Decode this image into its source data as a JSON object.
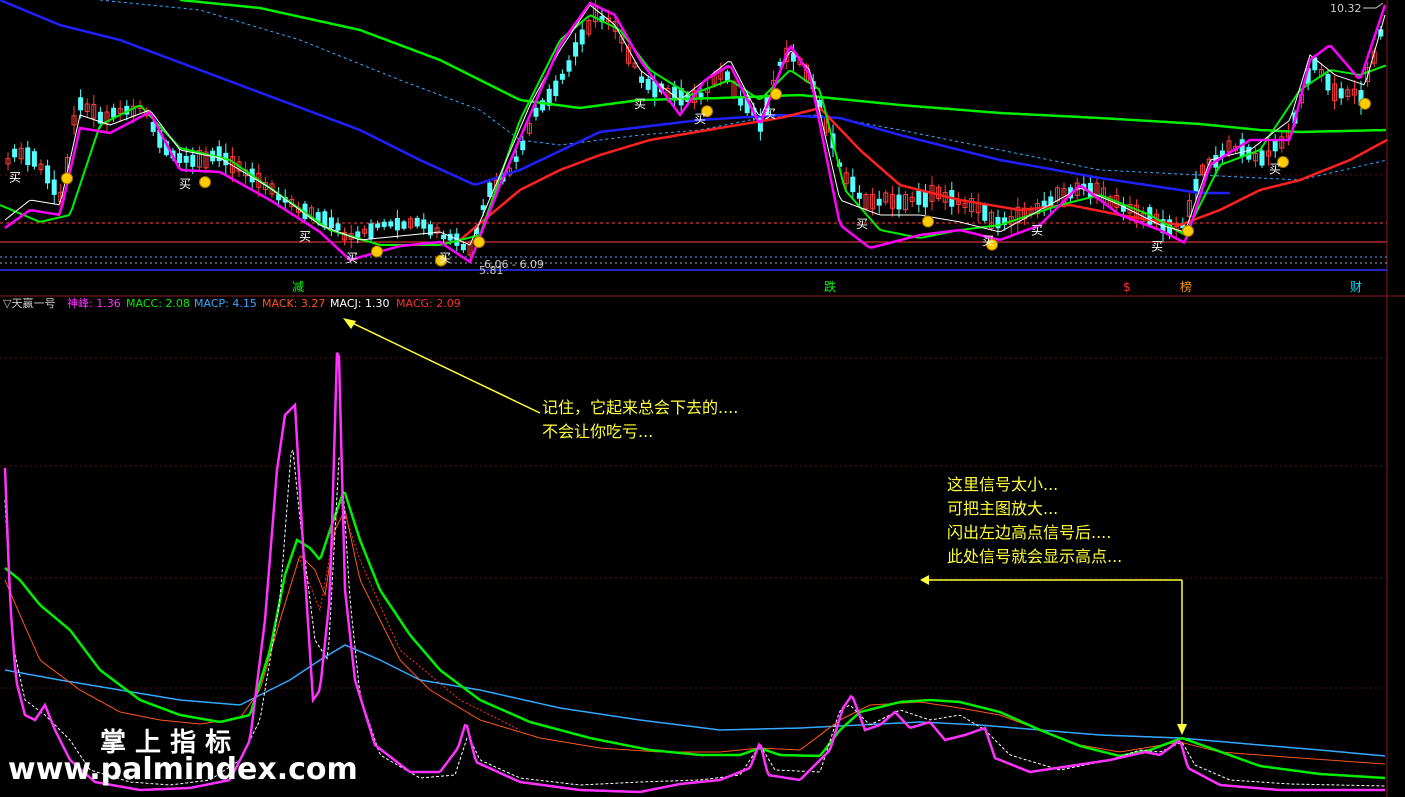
{
  "chart_data": [
    {
      "type": "candlestick",
      "panel": "main",
      "price_high_label": "10.32",
      "price_low_label": "5.81",
      "range_label": "6.06 - 6.09",
      "buy_markers": [
        {
          "label": "买",
          "x": 15
        },
        {
          "label": "买",
          "x": 185
        },
        {
          "label": "买",
          "x": 305
        },
        {
          "label": "买",
          "x": 352
        },
        {
          "label": "买",
          "x": 445
        },
        {
          "label": "买",
          "x": 640
        },
        {
          "label": "买",
          "x": 700
        },
        {
          "label": "买",
          "x": 770
        },
        {
          "label": "买",
          "x": 862
        },
        {
          "label": "买",
          "x": 988
        },
        {
          "label": "买",
          "x": 1037
        },
        {
          "label": "买",
          "x": 1157
        },
        {
          "label": "买",
          "x": 1275
        }
      ],
      "event_markers": [
        {
          "label": "减",
          "color": "#00ff00"
        },
        {
          "label": "跌",
          "color": "#00ff00"
        },
        {
          "label": "$",
          "color": "#ff3030"
        },
        {
          "label": "榜",
          "color": "#ff9900"
        },
        {
          "label": "财",
          "color": "#00ddff"
        }
      ],
      "colors": {
        "up": "#ff3c3c",
        "down": "#54ffff",
        "ma_fast": "#ffffff",
        "ma_red": "#ff2020",
        "ma_green": "#00ee00",
        "ma_blue": "#2020ff",
        "ma_magenta": "#ff00ff",
        "ma_dotted": "#33aaff"
      }
    },
    {
      "type": "line",
      "panel": "indicator",
      "title": "天赢一号",
      "series": [
        {
          "name": "神峰",
          "value": "1.36",
          "color": "#ff33ff"
        },
        {
          "name": "MACC",
          "value": "2.08",
          "color": "#00ee00"
        },
        {
          "name": "MACP",
          "value": "4.15",
          "color": "#33aaff"
        },
        {
          "name": "MACK",
          "value": "3.27",
          "color": "#ff5522"
        },
        {
          "name": "MACJ",
          "value": "1.30",
          "color": "#ffffff"
        },
        {
          "name": "MACG",
          "value": "2.09",
          "color": "#ff3030"
        }
      ]
    }
  ],
  "annotations": {
    "note1": [
      "记住，它起来总会下去的....",
      "不会让你吃亏..."
    ],
    "note2": [
      "这里信号太小...",
      "可把主图放大...",
      "闪出左边高点信号后....",
      "此处信号就会显示高点..."
    ]
  },
  "watermark": {
    "title": "掌 上 指 标",
    "url": "www.palmindex.com"
  }
}
